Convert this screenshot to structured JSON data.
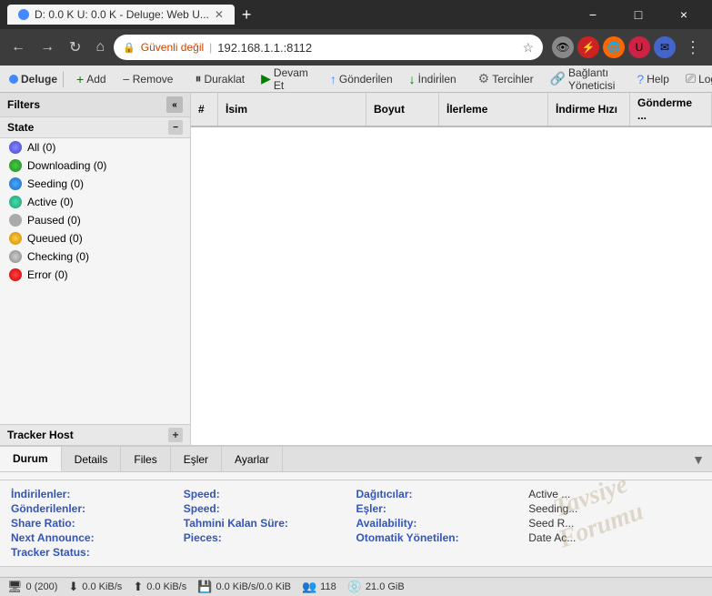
{
  "titlebar": {
    "title": "D: 0.0 K U: 0.0 K - Deluge: Web U...",
    "tab_label": "D: 0.0 K U: 0.0 K - Deluge: Web U...",
    "min_label": "−",
    "max_label": "□",
    "close_label": "×",
    "new_tab_label": "+"
  },
  "addressbar": {
    "back": "←",
    "forward": "→",
    "reload": "↻",
    "home": "⌂",
    "security": "Güvenli değil",
    "url": "192.168.1.1.:8112",
    "star": "☆",
    "menu": "⋮"
  },
  "toolbar": {
    "logo": "Deluge",
    "add": "Add",
    "remove": "Remove",
    "pause": "Duraklat",
    "resume": "Devam Et",
    "upload": "Gönderi̇len",
    "download": "İndi̇ri̇len",
    "settings": "Terci̇hler",
    "connections": "Bağlantı Yöneticisi",
    "help": "Help",
    "logout": "Logout"
  },
  "sidebar": {
    "header": "Filters",
    "state_section": "State",
    "items": [
      {
        "label": "All (0)",
        "type": "all"
      },
      {
        "label": "Downloading (0)",
        "type": "downloading"
      },
      {
        "label": "Seeding (0)",
        "type": "seeding"
      },
      {
        "label": "Active (0)",
        "type": "active"
      },
      {
        "label": "Paused (0)",
        "type": "paused"
      },
      {
        "label": "Queued (0)",
        "type": "queued"
      },
      {
        "label": "Checking (0)",
        "type": "checking"
      },
      {
        "label": "Error (0)",
        "type": "error"
      }
    ],
    "tracker_section": "Tracker Host"
  },
  "table": {
    "columns": [
      "#",
      "İsim",
      "Boyut",
      "İlerleme",
      "İndirme Hızı",
      "Gönderme ..."
    ]
  },
  "bottom_tabs": [
    "Durum",
    "Details",
    "Files",
    "Eşler",
    "Ayarlar"
  ],
  "details": {
    "row1": {
      "label1": "İndirilenler:",
      "val1": "",
      "label2": "Speed:",
      "val2": "",
      "label3": "Dağıtıcılar:",
      "val3": "",
      "label4": "Active ..."
    },
    "row2": {
      "label1": "Gönderilenler:",
      "val1": "",
      "label2": "Speed:",
      "val2": "",
      "label3": "Eşler:",
      "val3": "",
      "label4": "Seeding..."
    },
    "row3": {
      "label1": "Share Ratio:",
      "val1": "",
      "label2": "Tahmini Kalan Süre:",
      "val2": "",
      "label3": "Availability:",
      "val3": "",
      "label4": "Seed R..."
    },
    "row4": {
      "label1": "Next Announce:",
      "val1": "",
      "label2": "Pieces:",
      "val2": "",
      "label3": "Otomatik Yönetilen:",
      "val3": "",
      "label4": "Date Ac..."
    },
    "row5": {
      "label1": "Tracker Status:",
      "val1": ""
    }
  },
  "statusbar": {
    "connections": "0 (200)",
    "dl_speed": "0.0 KiB/s",
    "ul_speed": "0.0 KiB/s",
    "disk_speed": "0.0 KiB/s/0.0 KiB",
    "peers": "118",
    "disk": "21.0 GiB"
  },
  "watermark": {
    "line1": "Tavsiye",
    "line2": "Forumu"
  }
}
